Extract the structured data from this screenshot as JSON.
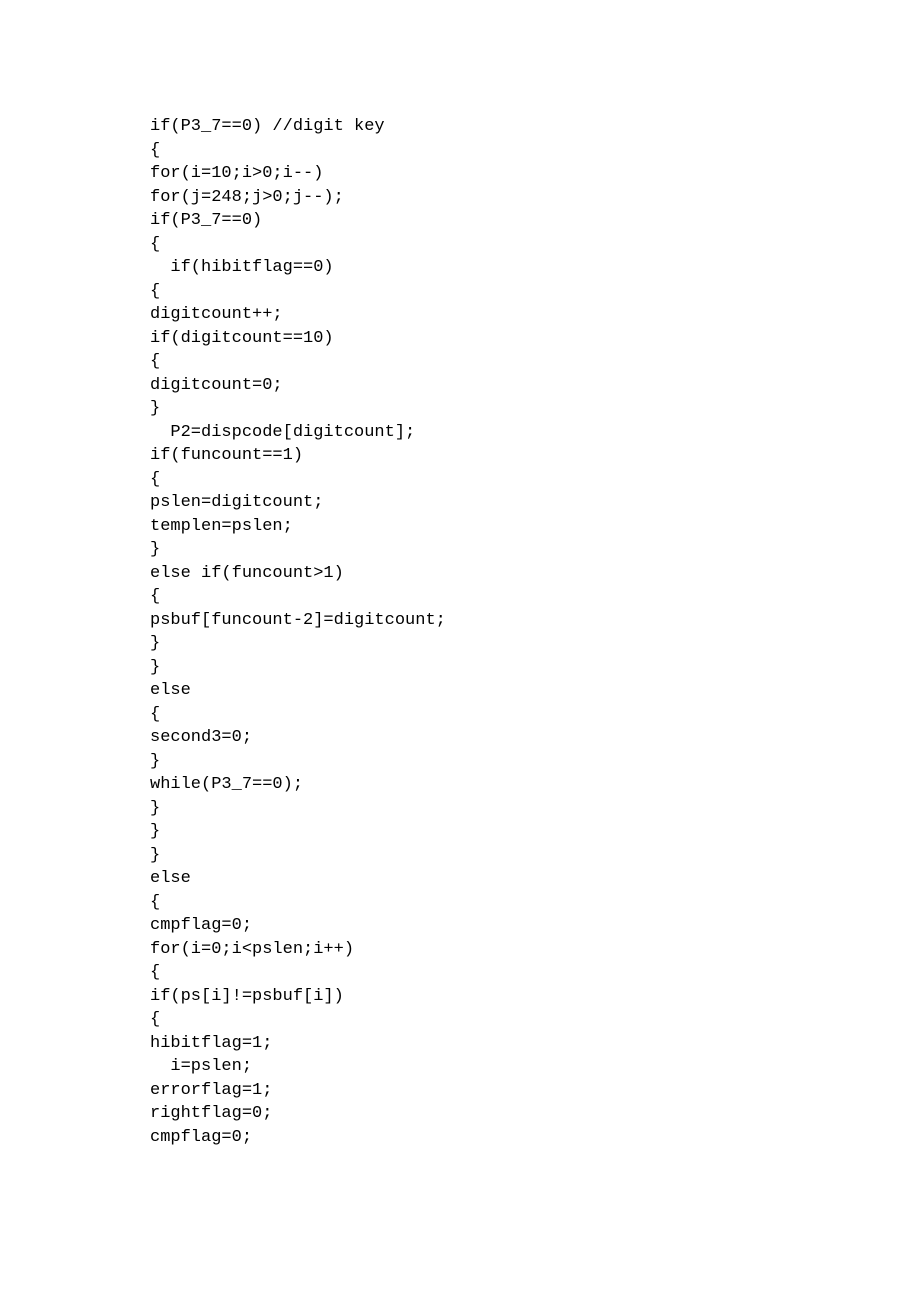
{
  "code_lines": [
    "if(P3_7==0) //digit key",
    "{",
    "for(i=10;i>0;i--)",
    "for(j=248;j>0;j--);",
    "if(P3_7==0)",
    "{",
    "  if(hibitflag==0)",
    "{",
    "digitcount++;",
    "if(digitcount==10)",
    "{",
    "digitcount=0;",
    "}",
    "  P2=dispcode[digitcount];",
    "if(funcount==1)",
    "{",
    "pslen=digitcount;",
    "templen=pslen;",
    "}",
    "else if(funcount>1)",
    "{",
    "psbuf[funcount-2]=digitcount;",
    "}",
    "}",
    "else",
    "{",
    "second3=0;",
    "}",
    "while(P3_7==0);",
    "}",
    "}",
    "}",
    "else",
    "{",
    "cmpflag=0;",
    "for(i=0;i<pslen;i++)",
    "{",
    "if(ps[i]!=psbuf[i])",
    "{",
    "hibitflag=1;",
    "  i=pslen;",
    "errorflag=1;",
    "rightflag=0;",
    "cmpflag=0;"
  ]
}
